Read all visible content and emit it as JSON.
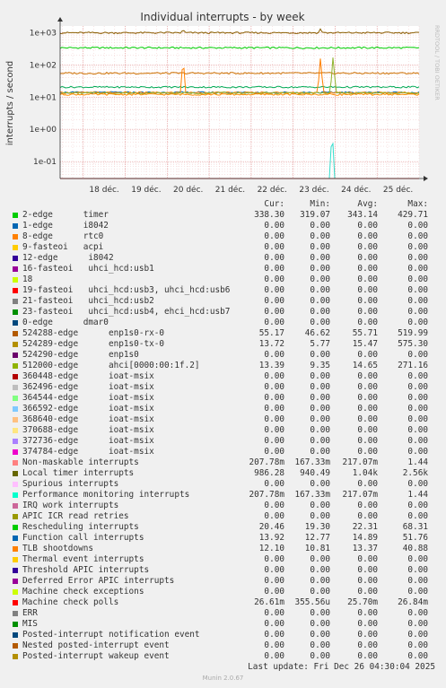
{
  "chart_data": {
    "type": "line",
    "title": "Individual interrupts - by week",
    "ylabel": "interrupts / second",
    "yscale": "log",
    "ylim": [
      0.03,
      1600
    ],
    "yticks": [
      {
        "value": 0.1,
        "label": "1e-01"
      },
      {
        "value": 1,
        "label": "1e+00"
      },
      {
        "value": 10,
        "label": "1e+01"
      },
      {
        "value": 100,
        "label": "1e+02"
      },
      {
        "value": 1000,
        "label": "1e+03"
      }
    ],
    "xticks": [
      "18 déc.",
      "19 déc.",
      "20 déc.",
      "21 déc.",
      "22 déc.",
      "23 déc.",
      "24 déc.",
      "25 déc."
    ],
    "watermark": "RRDTOOL / TOBI OETIKER",
    "drawn_series": [
      {
        "name": "2-edge timer",
        "level": 338.3,
        "color": "#00cc00"
      },
      {
        "name": "Local timer interrupts",
        "level": 986.28,
        "color": "#8a5f00",
        "spikes": [
          {
            "x": 2.38,
            "v": 1250
          },
          {
            "x": 5.65,
            "v": 1300
          }
        ]
      },
      {
        "name": "524288-edge enp1s0-rx-0",
        "level": 55.17,
        "color": "#cc7000"
      },
      {
        "name": "Rescheduling interrupts",
        "level": 20.46,
        "color": "#00aa55"
      },
      {
        "name": "Function call interrupts",
        "level": 13.92,
        "color": "#0066b3"
      },
      {
        "name": "524289-edge enp1s0-tx-0",
        "level": 13.72,
        "color": "#ff8000",
        "spikes": [
          {
            "x": 2.38,
            "v": 120
          },
          {
            "x": 5.65,
            "v": 160
          }
        ]
      },
      {
        "name": "512000-edge ahci[0000:00:1f.2]",
        "level": 13.39,
        "color": "#8fb32e",
        "spikes": [
          {
            "x": 5.95,
            "v": 175
          }
        ]
      },
      {
        "name": "TLB shootdowns",
        "level": 12.1,
        "color": "#ff8800"
      },
      {
        "name": "Performance monitoring interrupts",
        "level": 0.025,
        "color": "#33ddcc",
        "spikes": [
          {
            "x": 5.93,
            "v": 0.55
          }
        ]
      },
      {
        "name": "Non-maskable interrupts",
        "level": 0.025,
        "color": "#55cccc"
      },
      {
        "name": "Machine check polls",
        "level": 0.0266,
        "color": "#cc0000"
      }
    ]
  },
  "legend": {
    "headers": {
      "cur": "Cur:",
      "min": "Min:",
      "avg": "Avg:",
      "max": "Max:"
    },
    "rows": [
      {
        "label": "2-edge      timer",
        "color": "#00cc00",
        "cur": "338.30",
        "min": "319.07",
        "avg": "343.14",
        "max": "429.71"
      },
      {
        "label": "1-edge      i8042",
        "color": "#0066b3",
        "cur": "0.00",
        "min": "0.00",
        "avg": "0.00",
        "max": "0.00"
      },
      {
        "label": "8-edge      rtc0",
        "color": "#ff8000",
        "cur": "0.00",
        "min": "0.00",
        "avg": "0.00",
        "max": "0.00"
      },
      {
        "label": "9-fasteoi   acpi",
        "color": "#ffcc00",
        "cur": "0.00",
        "min": "0.00",
        "avg": "0.00",
        "max": "0.00"
      },
      {
        "label": "12-edge      i8042",
        "color": "#330099",
        "cur": "0.00",
        "min": "0.00",
        "avg": "0.00",
        "max": "0.00"
      },
      {
        "label": "16-fasteoi   uhci_hcd:usb1",
        "color": "#990099",
        "cur": "0.00",
        "min": "0.00",
        "avg": "0.00",
        "max": "0.00"
      },
      {
        "label": "18",
        "color": "#ccff00",
        "cur": "0.00",
        "min": "0.00",
        "avg": "0.00",
        "max": "0.00"
      },
      {
        "label": "19-fasteoi   uhci_hcd:usb3, uhci_hcd:usb6",
        "color": "#ff0000",
        "cur": "0.00",
        "min": "0.00",
        "avg": "0.00",
        "max": "0.00"
      },
      {
        "label": "21-fasteoi   uhci_hcd:usb2",
        "color": "#808080",
        "cur": "0.00",
        "min": "0.00",
        "avg": "0.00",
        "max": "0.00"
      },
      {
        "label": "23-fasteoi   uhci_hcd:usb4, ehci_hcd:usb7",
        "color": "#008f00",
        "cur": "0.00",
        "min": "0.00",
        "avg": "0.00",
        "max": "0.00"
      },
      {
        "label": "0-edge      dmar0",
        "color": "#00487d",
        "cur": "0.00",
        "min": "0.00",
        "avg": "0.00",
        "max": "0.00"
      },
      {
        "label": "524288-edge      enp1s0-rx-0",
        "color": "#b35a00",
        "cur": "55.17",
        "min": "46.62",
        "avg": "55.71",
        "max": "519.99"
      },
      {
        "label": "524289-edge      enp1s0-tx-0",
        "color": "#b38f00",
        "cur": "13.72",
        "min": "5.77",
        "avg": "15.47",
        "max": "575.30"
      },
      {
        "label": "524290-edge      enp1s0",
        "color": "#6b006b",
        "cur": "0.00",
        "min": "0.00",
        "avg": "0.00",
        "max": "0.00"
      },
      {
        "label": "512000-edge      ahci[0000:00:1f.2]",
        "color": "#8fb300",
        "cur": "13.39",
        "min": "9.35",
        "avg": "14.65",
        "max": "271.16"
      },
      {
        "label": "360448-edge      ioat-msix",
        "color": "#b30000",
        "cur": "0.00",
        "min": "0.00",
        "avg": "0.00",
        "max": "0.00"
      },
      {
        "label": "362496-edge      ioat-msix",
        "color": "#bebebe",
        "cur": "0.00",
        "min": "0.00",
        "avg": "0.00",
        "max": "0.00"
      },
      {
        "label": "364544-edge      ioat-msix",
        "color": "#80ff80",
        "cur": "0.00",
        "min": "0.00",
        "avg": "0.00",
        "max": "0.00"
      },
      {
        "label": "366592-edge      ioat-msix",
        "color": "#80c9ff",
        "cur": "0.00",
        "min": "0.00",
        "avg": "0.00",
        "max": "0.00"
      },
      {
        "label": "368640-edge      ioat-msix",
        "color": "#ffc080",
        "cur": "0.00",
        "min": "0.00",
        "avg": "0.00",
        "max": "0.00"
      },
      {
        "label": "370688-edge      ioat-msix",
        "color": "#ffe680",
        "cur": "0.00",
        "min": "0.00",
        "avg": "0.00",
        "max": "0.00"
      },
      {
        "label": "372736-edge      ioat-msix",
        "color": "#aa80ff",
        "cur": "0.00",
        "min": "0.00",
        "avg": "0.00",
        "max": "0.00"
      },
      {
        "label": "374784-edge      ioat-msix",
        "color": "#ee00cc",
        "cur": "0.00",
        "min": "0.00",
        "avg": "0.00",
        "max": "0.00"
      },
      {
        "label": "Non-maskable interrupts",
        "color": "#ff8080",
        "cur": "207.78m",
        "min": "167.33m",
        "avg": "217.07m",
        "max": "1.44"
      },
      {
        "label": "Local timer interrupts",
        "color": "#666600",
        "cur": "986.28",
        "min": "940.49",
        "avg": "1.04k",
        "max": "2.56k"
      },
      {
        "label": "Spurious interrupts",
        "color": "#ffbfff",
        "cur": "0.00",
        "min": "0.00",
        "avg": "0.00",
        "max": "0.00"
      },
      {
        "label": "Performance monitoring interrupts",
        "color": "#00ffcc",
        "cur": "207.78m",
        "min": "167.33m",
        "avg": "217.07m",
        "max": "1.44"
      },
      {
        "label": "IRQ work interrupts",
        "color": "#cc6699",
        "cur": "0.00",
        "min": "0.00",
        "avg": "0.00",
        "max": "0.00"
      },
      {
        "label": "APIC ICR read retries",
        "color": "#999900",
        "cur": "0.00",
        "min": "0.00",
        "avg": "0.00",
        "max": "0.00"
      },
      {
        "label": "Rescheduling interrupts",
        "color": "#00cc00",
        "cur": "20.46",
        "min": "19.30",
        "avg": "22.31",
        "max": "68.31"
      },
      {
        "label": "Function call interrupts",
        "color": "#0066b3",
        "cur": "13.92",
        "min": "12.77",
        "avg": "14.89",
        "max": "51.76"
      },
      {
        "label": "TLB shootdowns",
        "color": "#ff8000",
        "cur": "12.10",
        "min": "10.81",
        "avg": "13.37",
        "max": "40.88"
      },
      {
        "label": "Thermal event interrupts",
        "color": "#ffcc00",
        "cur": "0.00",
        "min": "0.00",
        "avg": "0.00",
        "max": "0.00"
      },
      {
        "label": "Threshold APIC interrupts",
        "color": "#330099",
        "cur": "0.00",
        "min": "0.00",
        "avg": "0.00",
        "max": "0.00"
      },
      {
        "label": "Deferred Error APIC interrupts",
        "color": "#990099",
        "cur": "0.00",
        "min": "0.00",
        "avg": "0.00",
        "max": "0.00"
      },
      {
        "label": "Machine check exceptions",
        "color": "#ccff00",
        "cur": "0.00",
        "min": "0.00",
        "avg": "0.00",
        "max": "0.00"
      },
      {
        "label": "Machine check polls",
        "color": "#ff0000",
        "cur": "26.61m",
        "min": "355.56u",
        "avg": "25.70m",
        "max": "26.84m"
      },
      {
        "label": "ERR",
        "color": "#808080",
        "cur": "0.00",
        "min": "0.00",
        "avg": "0.00",
        "max": "0.00"
      },
      {
        "label": "MIS",
        "color": "#008f00",
        "cur": "0.00",
        "min": "0.00",
        "avg": "0.00",
        "max": "0.00"
      },
      {
        "label": "Posted-interrupt notification event",
        "color": "#00487d",
        "cur": "0.00",
        "min": "0.00",
        "avg": "0.00",
        "max": "0.00"
      },
      {
        "label": "Nested posted-interrupt event",
        "color": "#b35a00",
        "cur": "0.00",
        "min": "0.00",
        "avg": "0.00",
        "max": "0.00"
      },
      {
        "label": "Posted-interrupt wakeup event",
        "color": "#b38f00",
        "cur": "0.00",
        "min": "0.00",
        "avg": "0.00",
        "max": "0.00"
      }
    ]
  },
  "footer": {
    "last_update": "Last update: Fri Dec 26 04:30:04 2025",
    "munin": "Munin 2.0.67"
  }
}
